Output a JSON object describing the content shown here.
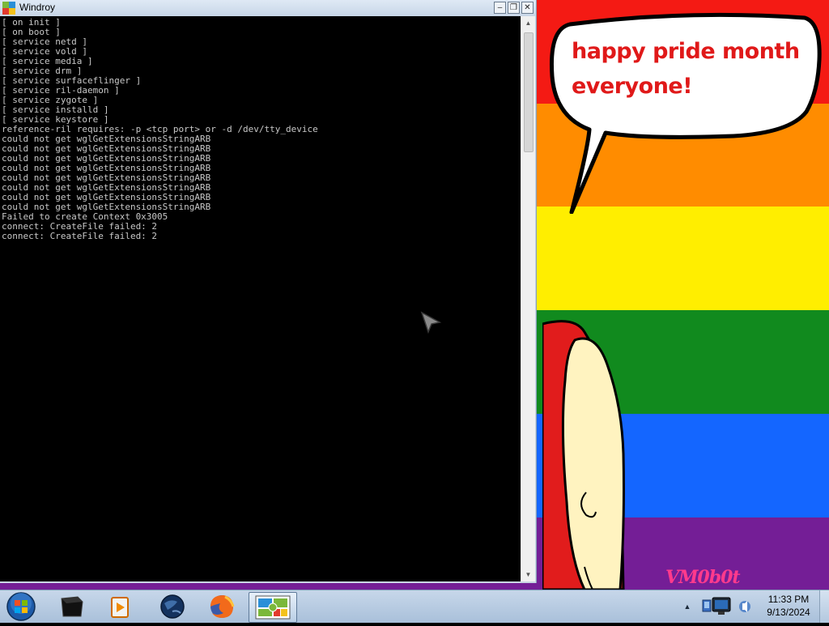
{
  "window": {
    "title": "Windroy",
    "buttons": {
      "minimize": "minimize",
      "restore": "restore",
      "close": "close"
    },
    "console_lines": [
      "[ on init ]",
      "[ on boot ]",
      "[ service netd ]",
      "[ service vold ]",
      "[ service media ]",
      "[ service drm ]",
      "[ service surfaceflinger ]",
      "[ service ril-daemon ]",
      "[ service zygote ]",
      "[ service installd ]",
      "[ service keystore ]",
      "reference-ril requires: -p <tcp port> or -d /dev/tty_device",
      "could not get wglGetExtensionsStringARB",
      "could not get wglGetExtensionsStringARB",
      "could not get wglGetExtensionsStringARB",
      "could not get wglGetExtensionsStringARB",
      "could not get wglGetExtensionsStringARB",
      "could not get wglGetExtensionsStringARB",
      "could not get wglGetExtensionsStringARB",
      "could not get wglGetExtensionsStringARB",
      "Failed to create Context 0x3005",
      "connect: CreateFile failed: 2",
      "connect: CreateFile failed: 2"
    ]
  },
  "wallpaper": {
    "colors": [
      "#f41a14",
      "#ff8c00",
      "#ffee00",
      "#118a1e",
      "#1466ff",
      "#741e96"
    ],
    "bubble_text": "happy pride month everyone!",
    "signature": "VM0b0t"
  },
  "taskbar": {
    "start_icon": "windows-start-orb-icon",
    "apps": [
      {
        "name": "console-app-icon"
      },
      {
        "name": "media-player-icon"
      },
      {
        "name": "globe-browser-icon"
      },
      {
        "name": "firefox-icon"
      },
      {
        "name": "windroy-icon",
        "active": true
      }
    ],
    "tray": {
      "show_hidden_icon": "up-arrow-icon",
      "icons": [
        "network-icon",
        "computer-icon",
        "volume-icon"
      ]
    },
    "clock": {
      "time": "11:33 PM",
      "date": "9/13/2024"
    }
  }
}
